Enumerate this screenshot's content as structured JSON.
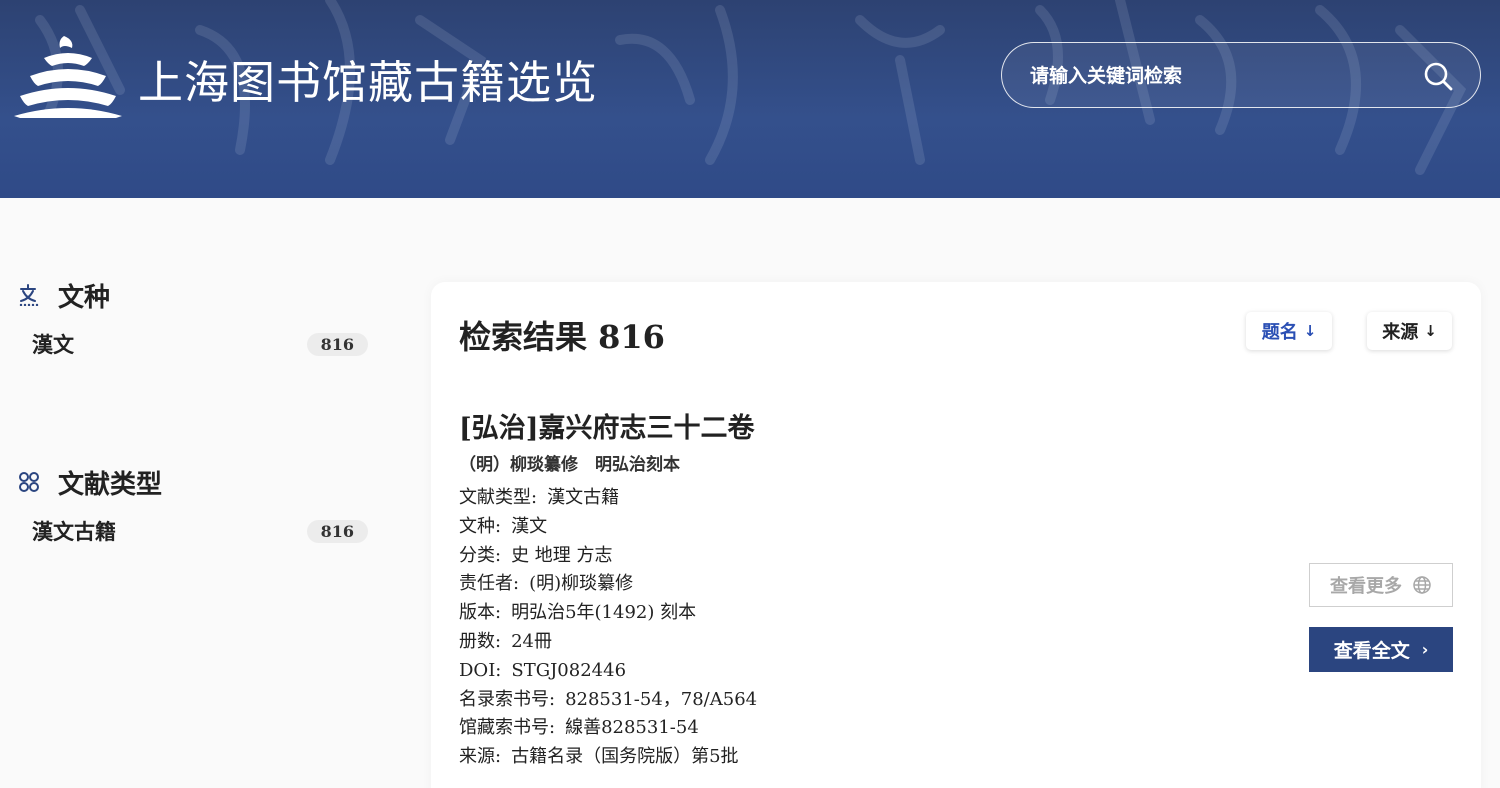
{
  "header": {
    "site_title": "上海图书馆藏古籍选览",
    "search": {
      "placeholder": "请输入关键词检索",
      "value": ""
    }
  },
  "sidebar": {
    "facets": [
      {
        "icon": "translate-icon",
        "title": "文种",
        "items": [
          {
            "label": "漢文",
            "count": "816"
          }
        ]
      },
      {
        "icon": "grid-icon",
        "title": "文献类型",
        "items": [
          {
            "label": "漢文古籍",
            "count": "816"
          }
        ]
      }
    ]
  },
  "results": {
    "heading": "检索结果 816",
    "sort_buttons": [
      {
        "label": "题名",
        "arrow": "↓",
        "active": true
      },
      {
        "label": "来源",
        "arrow": "↓",
        "active": false
      }
    ],
    "items": [
      {
        "title": "[弘治]嘉兴府志三十二卷",
        "subtitle": "（明）柳琰纂修　明弘治刻本",
        "fields": [
          {
            "key": "文献类型:",
            "value": "漢文古籍"
          },
          {
            "key": "文种:",
            "value": "漢文"
          },
          {
            "key": "分类:",
            "value": "史 地理 方志"
          },
          {
            "key": "责任者:",
            "value": "(明)柳琰纂修"
          },
          {
            "key": "版本:",
            "value": "明弘治5年(1492) 刻本"
          },
          {
            "key": "册数:",
            "value": "24冊"
          },
          {
            "key": "DOI:",
            "value": "STGJ082446"
          },
          {
            "key": "名录索书号:",
            "value": "828531-54，78/A564"
          },
          {
            "key": "馆藏索书号:",
            "value": "線善828531-54"
          },
          {
            "key": "来源:",
            "value": "古籍名录（国务院版）第5批"
          }
        ],
        "buttons": {
          "more": "查看更多",
          "full": "查看全文",
          "full_chevron": "›"
        }
      }
    ]
  },
  "colors": {
    "header_bg": "#2f4a87",
    "accent_blue": "#2a4fb4",
    "primary_button": "#2b4580"
  }
}
